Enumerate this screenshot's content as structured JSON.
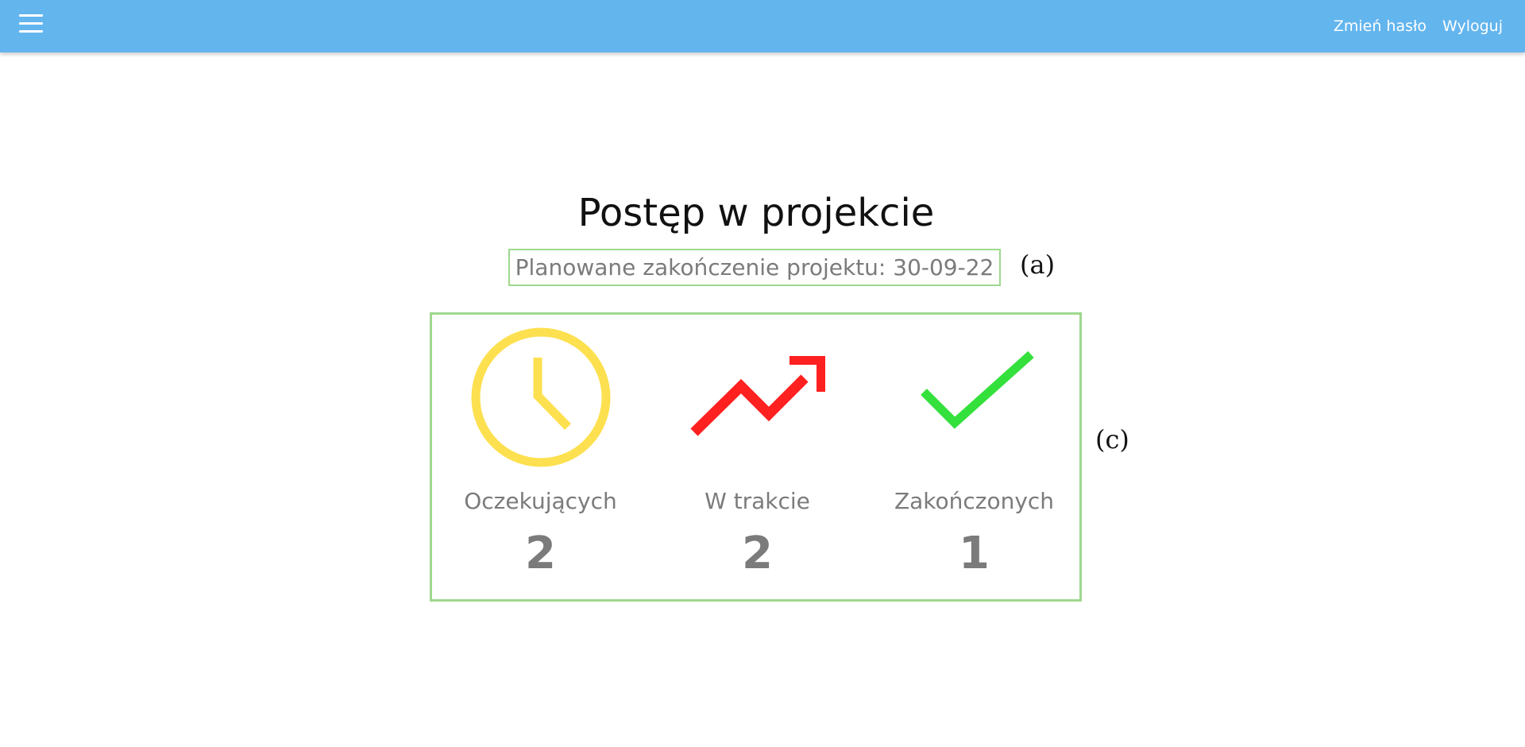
{
  "topbar": {
    "menu_icon": "hamburger-icon",
    "change_password_label": "Zmień hasło",
    "logout_label": "Wyloguj",
    "bg_color": "#63b5ee"
  },
  "main": {
    "title": "Postęp w projekcie",
    "deadline": "Planowane zakończenie projektu: 30-09-22",
    "stats": [
      {
        "label": "Oczekujących",
        "count": "2",
        "icon": "clock-icon",
        "color": "#fde04f"
      },
      {
        "label": "W trakcie",
        "count": "2",
        "icon": "trending-up-icon",
        "color": "#ff2020"
      },
      {
        "label": "Zakończonych",
        "count": "1",
        "icon": "checkmark-icon",
        "color": "#34e03c"
      }
    ]
  },
  "annotations": {
    "a": "(a)",
    "c": "(c)"
  }
}
